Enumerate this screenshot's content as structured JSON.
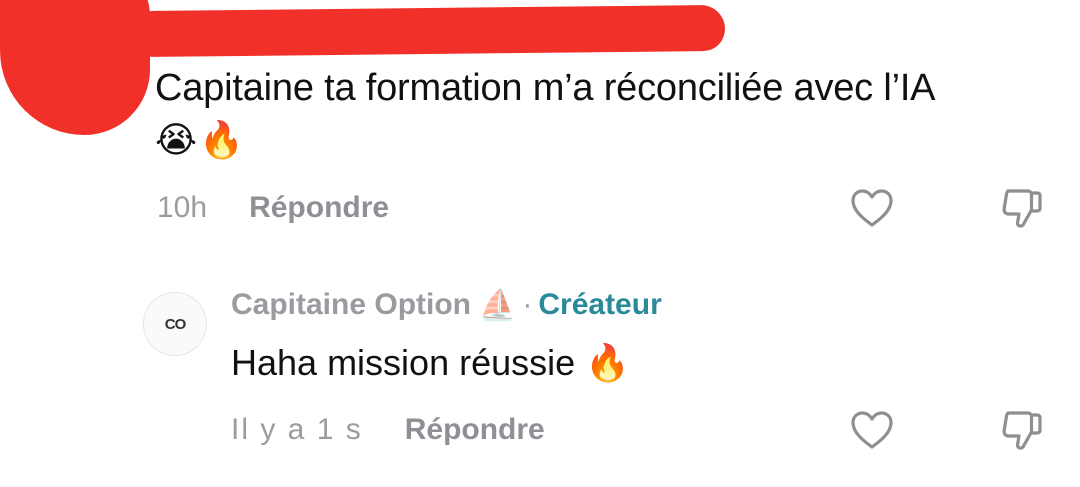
{
  "comment": {
    "text": "Capitaine ta formation m’a réconciliée avec l’IA",
    "emoji_1": "😭",
    "emoji_2": "🔥",
    "time": "10h",
    "reply_label": "Répondre"
  },
  "reply": {
    "avatar_text": "CO",
    "author": "Capitaine Option",
    "author_emoji": "⛵",
    "separator": "·",
    "badge": "Créateur",
    "text": "Haha mission réussie",
    "emoji": "🔥",
    "time": "Il y a 1 s",
    "reply_label": "Répondre"
  },
  "colors": {
    "redaction": "#f2302a",
    "creator_badge": "#2a8a9a",
    "muted_text": "#9a9aa0"
  },
  "icons": [
    "heart-icon",
    "thumbs-down-icon"
  ]
}
